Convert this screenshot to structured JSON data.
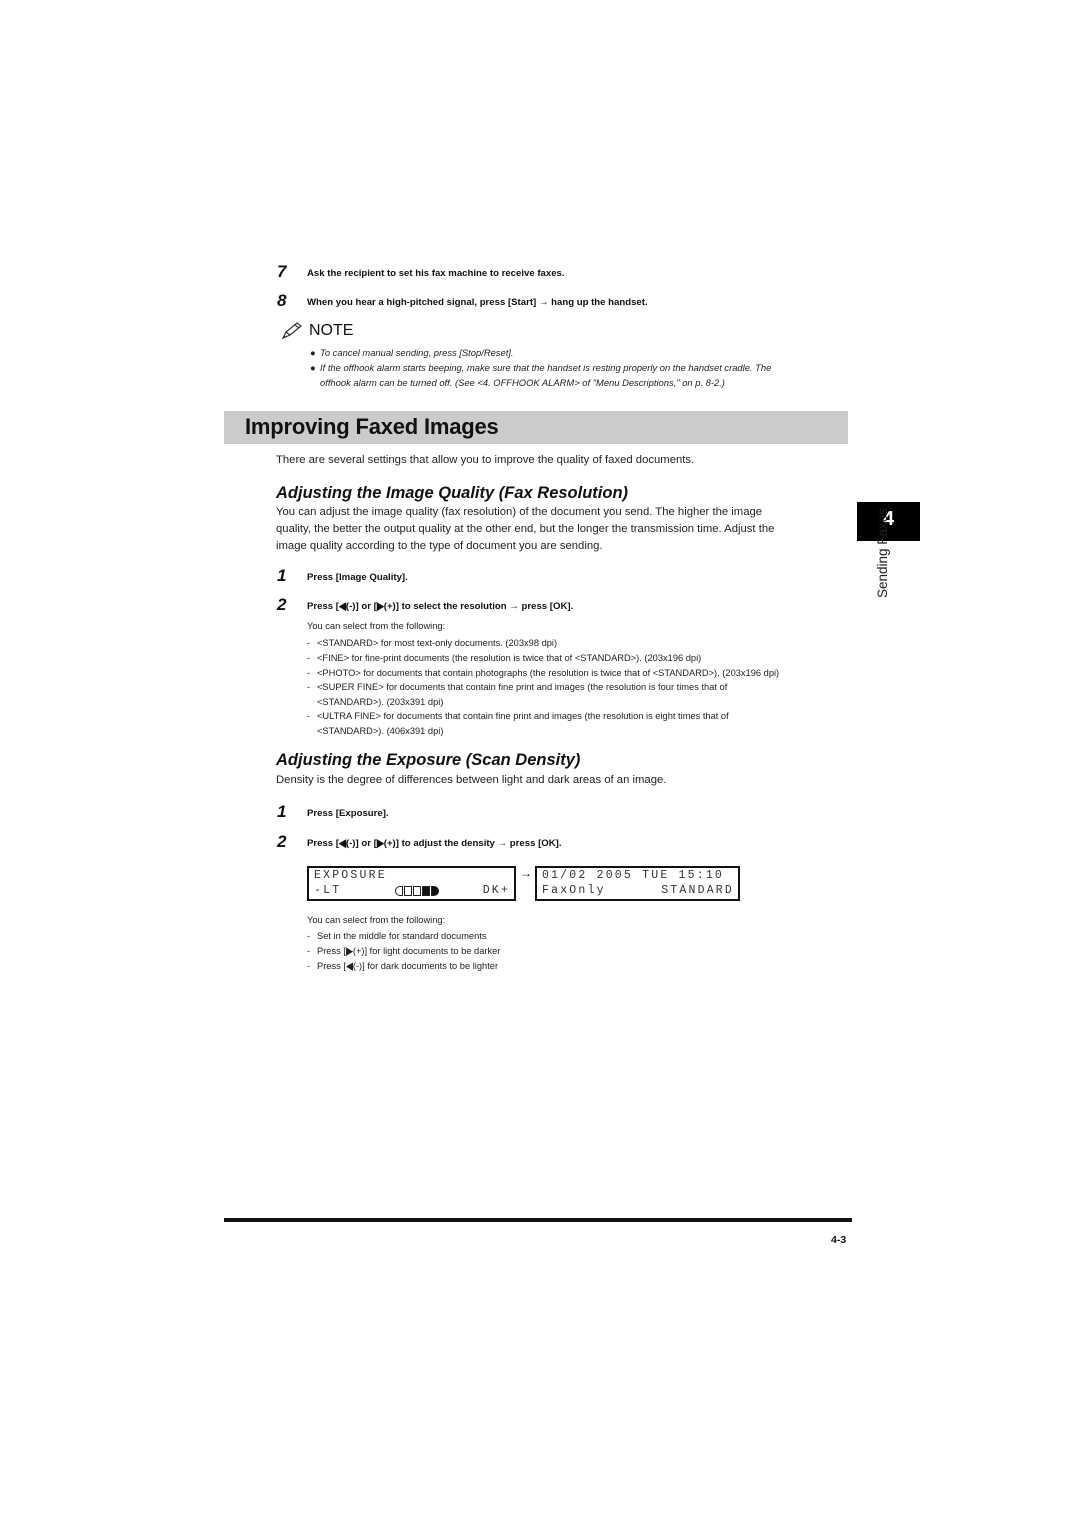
{
  "steps_top": [
    {
      "number": "7",
      "text": "Ask the recipient to set his fax machine to receive faxes."
    },
    {
      "number": "8",
      "text": "When you hear a high-pitched signal, press [Start] → hang up the handset."
    }
  ],
  "note": {
    "icon": "pencil-icon",
    "title": "NOTE",
    "items": [
      [
        "To cancel manual sending, press [Stop/Reset]."
      ],
      [
        "If the offhook alarm starts beeping, make sure that the handset is resting properly on the handset cradle. The",
        "offhook alarm can be turned off. (See <4. OFFHOOK ALARM> of \"Menu Descriptions,\" on p. 8-2.)"
      ]
    ]
  },
  "section": {
    "title": "Improving Faxed Images",
    "intro": "There are several settings that allow you to improve the quality of faxed documents."
  },
  "resolution": {
    "heading": "Adjusting the Image Quality (Fax Resolution)",
    "body": [
      "You can adjust the image quality (fax resolution) of the document you send. The higher the image",
      "quality, the better the output quality at the other end, but the longer the transmission time. Adjust the",
      "image quality according to the type of document you are sending."
    ],
    "steps": [
      {
        "number": "1",
        "text": "Press [Image Quality]."
      },
      {
        "number": "2",
        "text_a": "Press [",
        "left_key": "(-)] or [",
        "right_key": "(+)] to select the resolution → press [OK]."
      }
    ],
    "options_intro": "You can select from the following:",
    "options": [
      [
        "<STANDARD> for most text-only documents. (203x98 dpi)"
      ],
      [
        "<FINE> for fine-print documents (the resolution is twice that of <STANDARD>). (203x196 dpi)"
      ],
      [
        "<PHOTO> for documents that contain photographs (the resolution is twice that of <STANDARD>). (203x196 dpi)"
      ],
      [
        "<SUPER FINE> for documents that contain fine print and images (the resolution is four times that of",
        "<STANDARD>). (203x391 dpi)"
      ],
      [
        "<ULTRA FINE> for documents that contain fine print and images (the resolution is eight times that of",
        "<STANDARD>). (406x391 dpi)"
      ]
    ]
  },
  "exposure": {
    "heading": "Adjusting the Exposure (Scan Density)",
    "body": "Density is the degree of differences between light and dark areas of an image.",
    "steps": [
      {
        "number": "1",
        "text": "Press [Exposure]."
      },
      {
        "number": "2",
        "text_a": "Press [",
        "left_key": "(-)] or [",
        "right_key": "(+)] to adjust the density → press [OK]."
      }
    ],
    "lcd_before": {
      "line1": "EXPOSURE",
      "left_label": "-LT",
      "right_label": "DK+",
      "density_segments": [
        false,
        false,
        false,
        true,
        true
      ]
    },
    "lcd_arrow": "→",
    "lcd_after": {
      "line1": "01/02 2005 TUE 15:10",
      "line2_left": "FaxOnly",
      "line2_right": "STANDARD"
    },
    "options_intro": "You can select from the following:",
    "options": [
      {
        "text": "Set in the middle for standard documents"
      },
      {
        "pre": "Press [",
        "key": "right",
        "post": "(+)] for light documents to be darker"
      },
      {
        "pre": "Press [",
        "key": "left",
        "post": "(-)] for dark documents to be lighter"
      }
    ]
  },
  "chapter_tab": {
    "number": "4",
    "label": "Sending Faxes"
  },
  "footer": {
    "page_number": "4-3"
  },
  "glyphs": {
    "left_triangle": "◀",
    "right_triangle": "▶",
    "bullet": "●",
    "dash": "-"
  }
}
